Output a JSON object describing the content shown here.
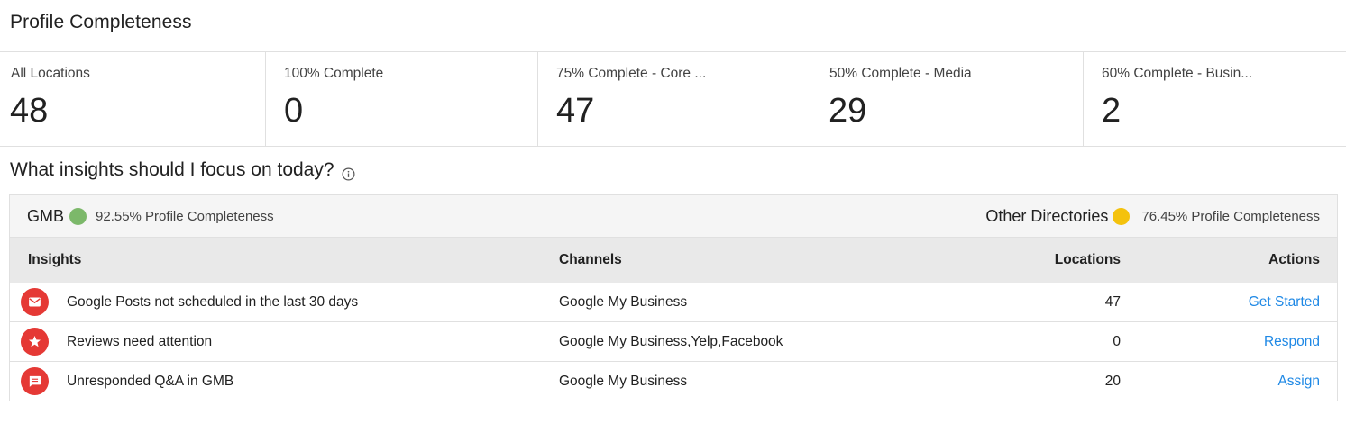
{
  "page": {
    "title": "Profile Completeness"
  },
  "stats": [
    {
      "label": "All Locations",
      "value": "48"
    },
    {
      "label": "100% Complete",
      "value": "0"
    },
    {
      "label": "75% Complete - Core ...",
      "value": "47"
    },
    {
      "label": "50% Complete - Media",
      "value": "29"
    },
    {
      "label": "60% Complete - Busin...",
      "value": "2"
    }
  ],
  "insights": {
    "title": "What insights should I focus on today?",
    "info_icon": "info-circle-icon",
    "summary": {
      "gmb": {
        "name": "GMB",
        "status_color": "#7cb86a",
        "text": "92.55% Profile Completeness"
      },
      "other": {
        "name": "Other Directories",
        "status_color": "#f4c20d",
        "text": "76.45% Profile Completeness"
      }
    },
    "columns": {
      "insight": "Insights",
      "channels": "Channels",
      "locations": "Locations",
      "actions": "Actions"
    },
    "rows": [
      {
        "icon": "email-icon",
        "insight": "Google Posts not scheduled in the last 30 days",
        "channels": "Google My Business",
        "locations": "47",
        "action": "Get Started"
      },
      {
        "icon": "star-icon",
        "insight": "Reviews need attention",
        "channels": "Google My Business,Yelp,Facebook",
        "locations": "0",
        "action": "Respond"
      },
      {
        "icon": "chat-message-icon",
        "insight": "Unresponded Q&A in GMB",
        "channels": "Google My Business",
        "locations": "20",
        "action": "Assign"
      }
    ]
  },
  "colors": {
    "accent_link": "#1e88e5",
    "icon_red": "#e53935"
  }
}
